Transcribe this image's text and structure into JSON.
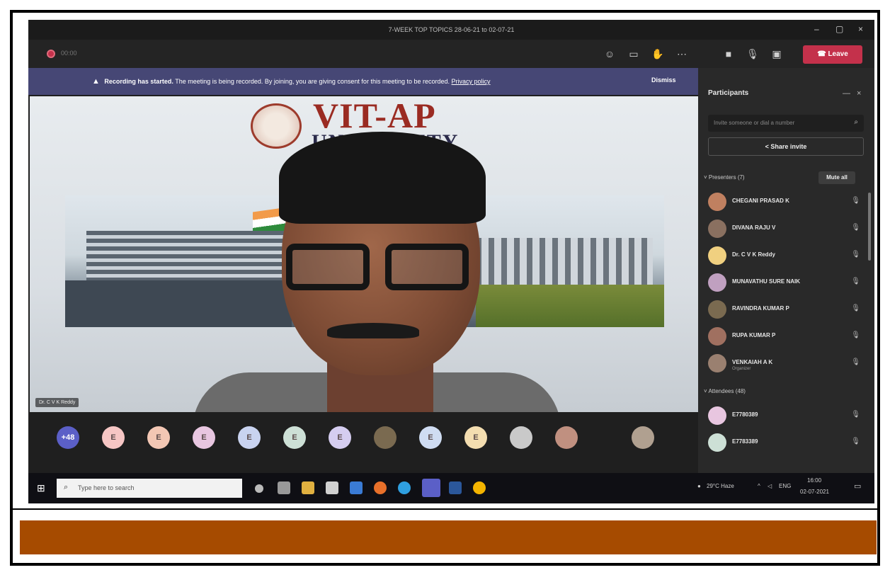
{
  "window": {
    "title": "7-WEEK TOP TOPICS 28-06-21 to 02-07-21"
  },
  "toolbar": {
    "timer": "00:00",
    "leave_label": "Leave"
  },
  "banner": {
    "bold": "Recording has started.",
    "message": "The meeting is being recorded. By joining, you are giving consent for this meeting to be recorded.",
    "link": "Privacy policy",
    "dismiss": "Dismiss"
  },
  "stage": {
    "logo_title": "VIT-AP",
    "logo_subtitle": "UNIVERSITY",
    "speaker_name": "Dr. C V K Reddy"
  },
  "avatars": [
    {
      "initials": "+48",
      "color": "#5b5fc7"
    },
    {
      "initials": "E",
      "color": "#f6c6c4"
    },
    {
      "initials": "E",
      "color": "#f3c7b4"
    },
    {
      "initials": "E",
      "color": "#e8c6e0"
    },
    {
      "initials": "E",
      "color": "#c9d3f0"
    },
    {
      "initials": "E",
      "color": "#cde0d6"
    },
    {
      "initials": "E",
      "color": "#d5cdf0"
    },
    {
      "initials": "",
      "color": "#7a6a50"
    },
    {
      "initials": "E",
      "color": "#cfdcf2"
    },
    {
      "initials": "E",
      "color": "#f3ddb0"
    },
    {
      "initials": "",
      "color": "#c9c9c9"
    },
    {
      "initials": "",
      "color": "#c09080"
    },
    {
      "initials": "",
      "color": "#b0a090"
    }
  ],
  "participants": {
    "title": "Participants",
    "invite_placeholder": "Invite someone or dial a number",
    "share_invite": "Share invite",
    "presenters_label": "Presenters (7)",
    "mute_all": "Mute all",
    "attendees_label": "Attendees (48)",
    "presenters": [
      {
        "name": "CHEGANI PRASAD K",
        "sub": "",
        "color": "#c08060"
      },
      {
        "name": "DIVANA RAJU V",
        "sub": "",
        "color": "#8a7060"
      },
      {
        "name": "Dr. C V K Reddy",
        "sub": "",
        "color": "#f0d080"
      },
      {
        "name": "MUNAVATHU SURE NAIK",
        "sub": "",
        "color": "#c0a0c0"
      },
      {
        "name": "RAVINDRA KUMAR P",
        "sub": "",
        "color": "#7a6a50"
      },
      {
        "name": "RUPA KUMAR P",
        "sub": "",
        "color": "#a07060"
      },
      {
        "name": "VENKAIAH A K",
        "sub": "Organizer",
        "color": "#9a8070"
      }
    ],
    "attendees": [
      {
        "name": "E7780389",
        "color": "#e8c6e0"
      },
      {
        "name": "E7783389",
        "color": "#cde0d6"
      }
    ]
  },
  "taskbar": {
    "search_placeholder": "Type here to search",
    "weather": "29°C Haze",
    "language": "ENG",
    "time": "16:00",
    "date": "02-07-2021"
  },
  "colors": {
    "leave": "#c4314b",
    "banner": "#464775",
    "footer_bar": "#a64b00"
  }
}
